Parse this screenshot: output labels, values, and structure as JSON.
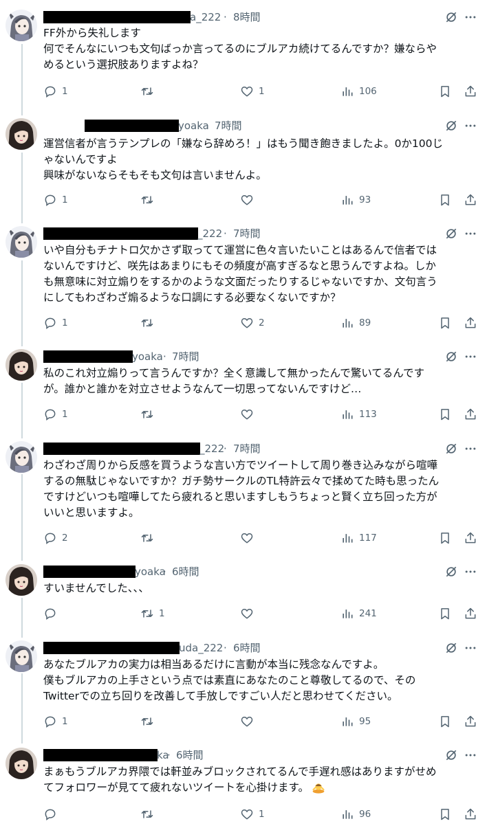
{
  "tweets": [
    {
      "user": "A",
      "handle_tail": "a_222",
      "sep": "·",
      "time": "8時間",
      "lines": [
        "FF外から失礼します",
        "何でそんなにいつも文句ばっか言ってるのにブルアカ続けてるんですか？嫌ならや",
        "めるという選択肢ありますよね？"
      ],
      "replies": "1",
      "retweets": "",
      "likes": "1",
      "views": "106"
    },
    {
      "user": "B",
      "handle_tail": "yoaka",
      "sep": "·",
      "time": "7時間",
      "lines": [
        "運営信者が言うテンプレの「嫌なら辞めろ！」はもう聞き飽きましたよ。0か100じ",
        "ゃないんですよ",
        "興味がないならそもそも文句は言いませんよ。"
      ],
      "replies": "1",
      "retweets": "",
      "likes": "",
      "views": "93"
    },
    {
      "user": "A",
      "handle_tail": "_222",
      "sep": "·",
      "time": "7時間",
      "lines": [
        "いや自分もチナトロ欠かさず取ってて運営に色々言いたいことはあるんで信者では",
        "ないんですけど、咲先はあまりにもその頻度が高すぎるなと思うんですよね。しか",
        "も無意味に対立煽りをするかのような文面だったりするじゃないですか、文句言う",
        "にしてもわざわざ煽るような口調にする必要なくないですか？"
      ],
      "replies": "1",
      "retweets": "",
      "likes": "2",
      "views": "89"
    },
    {
      "user": "B",
      "handle_tail": "yoaka",
      "sep": "·",
      "time": "7時間",
      "lines": [
        "私のこれ対立煽りって言うんですか？全く意識して無かったんで驚いてるんです",
        "が。誰かと誰かを対立させようなんて一切思ってないんですけど…"
      ],
      "replies": "1",
      "retweets": "",
      "likes": "",
      "views": "113"
    },
    {
      "user": "A",
      "handle_tail": "_222",
      "sep": "·",
      "time": "7時間",
      "lines": [
        "わざわざ周りから反感を買うような言い方でツイートして周り巻き込みながら喧嘩",
        "するの無駄じゃないですか？ガチ勢サークルのTL特許云々で揉めてた時も思ったん",
        "ですけどいつも喧嘩してたら疲れると思いますしもうちょっと賢く立ち回った方が",
        "いいと思いますよ。"
      ],
      "replies": "2",
      "retweets": "",
      "likes": "",
      "views": "117"
    },
    {
      "user": "B",
      "handle_tail": "yoaka",
      "sep": "·",
      "time": "6時間",
      "lines": [
        "すいませんでした、、、"
      ],
      "replies": "",
      "retweets": "1",
      "likes": "",
      "views": "241"
    },
    {
      "user": "A",
      "handle_tail": "uda_222",
      "sep": "·",
      "time": "6時間",
      "lines": [
        "あなたブルアカの実力は相当あるだけに言動が本当に残念なんですよ。",
        "僕もブルアカの上手さという点では素直にあなたのこと尊敬してるので、その",
        "Twitterでの立ち回りを改善して手放しですごい人だと思わせてください。"
      ],
      "replies": "1",
      "retweets": "",
      "likes": "",
      "views": "95"
    },
    {
      "user": "B",
      "handle_tail": "ka",
      "sep": "·",
      "time": "6時間",
      "lines": [
        "まぁもうブルアカ界隈では軒並みブロックされてるんで手遅れ感はありますがせめ",
        "てフォロワーが見てて疲れないツイートを心掛けます。"
      ],
      "emoji": "bowing-person-emoji",
      "replies": "",
      "retweets": "",
      "likes": "1",
      "views": "96"
    }
  ],
  "icons": {
    "reply": "reply-icon",
    "retweet": "retweet-icon",
    "like": "like-icon",
    "views": "views-icon",
    "bookmark": "bookmark-icon",
    "share": "share-icon",
    "grok": "grok-icon",
    "more": "more-icon"
  },
  "colors": {
    "text": "#0f1419",
    "muted": "#536471",
    "thread_line": "#cfd9de",
    "redaction": "#000000"
  }
}
